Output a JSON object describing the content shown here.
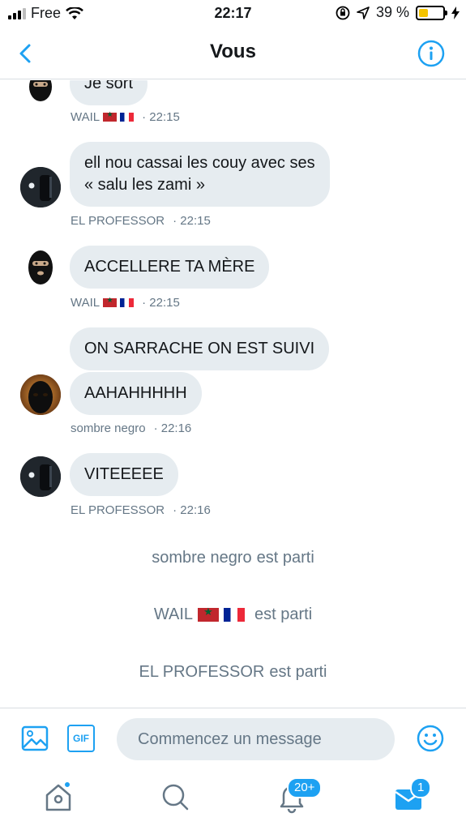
{
  "status_bar": {
    "carrier": "Free",
    "time": "22:17",
    "battery_percent": "39 %",
    "battery_level": 0.39,
    "icons": [
      "signal-icon",
      "wifi-icon",
      "orientation-lock-icon",
      "location-icon",
      "battery-icon",
      "charging-icon"
    ]
  },
  "nav": {
    "title": "Vous",
    "back_icon": "chevron-left-icon",
    "info_icon": "info-icon"
  },
  "messages": [
    {
      "sender": "WAIL",
      "sender_flags": [
        "ma",
        "fr"
      ],
      "text": "Je sort",
      "time": "· 22:15",
      "avatar": "balaclava"
    },
    {
      "sender": "EL PROFESSOR",
      "sender_flags": [],
      "text": "ell nou cassai les couy avec ses\n« salu les zami »",
      "time": "· 22:15",
      "avatar": "dark-figure"
    },
    {
      "sender": "WAIL",
      "sender_flags": [
        "ma",
        "fr"
      ],
      "text": "ACCELLERE TA MÈRE",
      "time": "· 22:15",
      "avatar": "balaclava"
    },
    {
      "sender": "sombre negro",
      "sender_flags": [],
      "texts": [
        "ON SARRACHE ON EST SUIVI",
        "AAHAHHHHH"
      ],
      "time": "· 22:16",
      "avatar": "mask-orange"
    },
    {
      "sender": "EL PROFESSOR",
      "sender_flags": [],
      "text": "VITEEEEE",
      "time": "· 22:16",
      "avatar": "dark-figure"
    }
  ],
  "system_messages": [
    {
      "name": "sombre negro",
      "flags": [],
      "action": "est parti"
    },
    {
      "name": "WAIL",
      "flags": [
        "ma",
        "fr"
      ],
      "action": "est parti"
    },
    {
      "name": "EL PROFESSOR",
      "flags": [],
      "action": "est parti"
    }
  ],
  "composer": {
    "placeholder": "Commencez un message",
    "gif_label": "GIF",
    "icons": [
      "image-icon",
      "gif-icon",
      "emoji-icon"
    ]
  },
  "tabbar": {
    "home_icon": "home-icon",
    "search_icon": "search-icon",
    "notifications_icon": "bell-icon",
    "notifications_badge": "20+",
    "messages_icon": "mail-icon",
    "messages_badge": "1"
  },
  "colors": {
    "accent": "#1da1f2",
    "bubble": "#e6ecf0",
    "meta_text": "#657786"
  }
}
